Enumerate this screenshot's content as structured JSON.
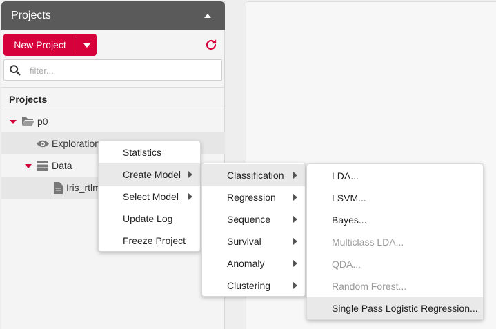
{
  "panel": {
    "title": "Projects",
    "new_project_label": "New Project",
    "filter_placeholder": "filter...",
    "section_title": "Projects"
  },
  "tree": {
    "project": "p0",
    "exploration": "Exploration",
    "data": "Data",
    "file": "Iris_rtlm"
  },
  "context_menu": [
    "Statistics",
    "Create Model",
    "Select Model",
    "Update Log",
    "Freeze Project"
  ],
  "create_model_menu": [
    "Classification",
    "Regression",
    "Sequence",
    "Survival",
    "Anomaly",
    "Clustering"
  ],
  "classification_menu": [
    {
      "label": "LDA...",
      "enabled": true
    },
    {
      "label": "LSVM...",
      "enabled": true
    },
    {
      "label": "Bayes...",
      "enabled": true
    },
    {
      "label": "Multiclass LDA...",
      "enabled": false
    },
    {
      "label": "QDA...",
      "enabled": false
    },
    {
      "label": "Random Forest...",
      "enabled": false
    },
    {
      "label": "Single Pass Logistic Regression...",
      "enabled": true
    }
  ],
  "colors": {
    "accent": "#d6003b",
    "header": "#5a5a5a"
  }
}
